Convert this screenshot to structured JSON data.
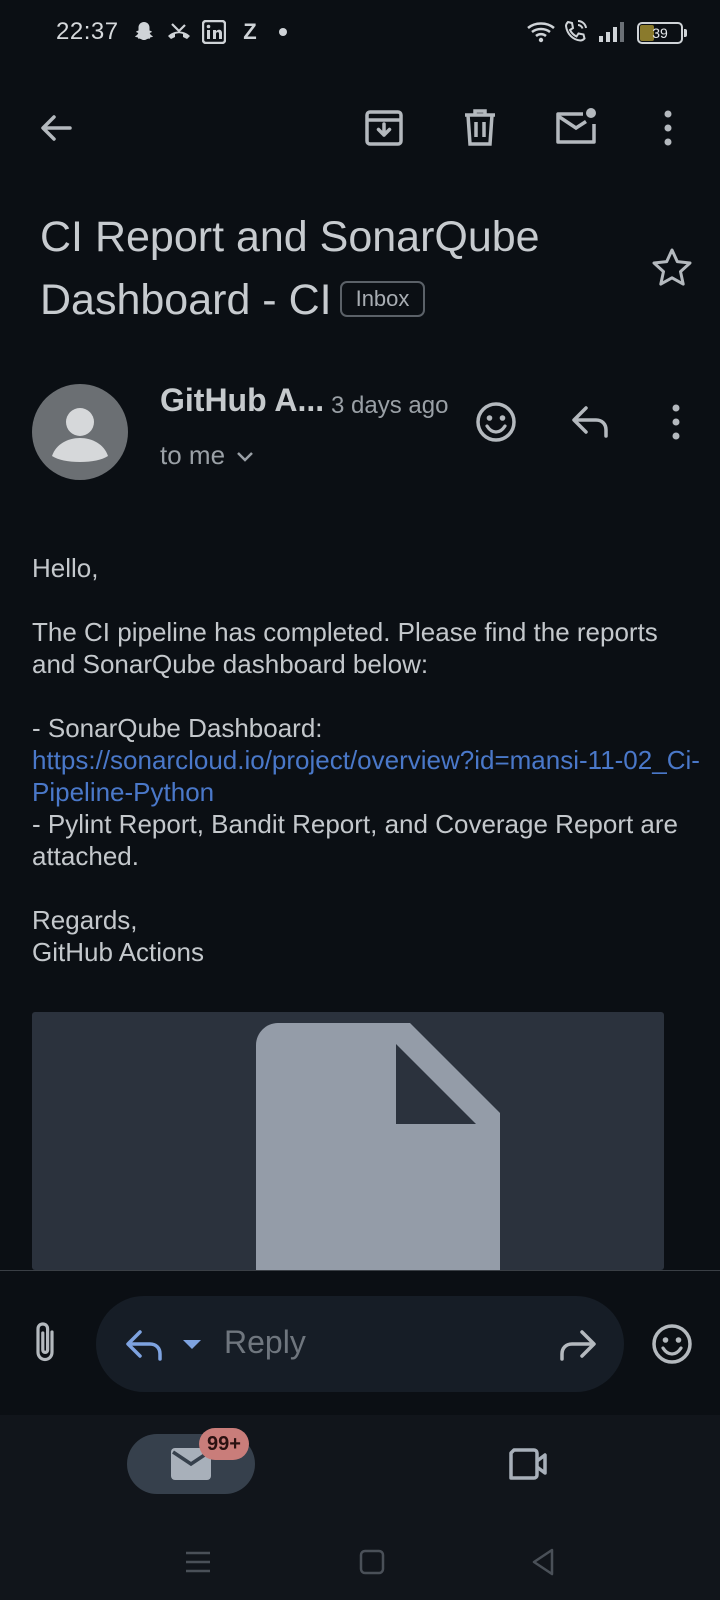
{
  "status_bar": {
    "time": "22:37",
    "left_icons": [
      "snapchat-icon",
      "missed-call-icon",
      "linkedin-icon",
      "z-icon",
      "dot-icon"
    ],
    "right_icons": [
      "wifi-icon",
      "wifi-calling-icon",
      "signal-icon"
    ],
    "battery_level": "39"
  },
  "toolbar": {
    "icons": [
      "back-arrow-icon",
      "archive-icon",
      "delete-icon",
      "mark-unread-icon",
      "more-vert-icon"
    ]
  },
  "email": {
    "subject": "CI Report and SonarQube Dashboard - CI",
    "label": "Inbox",
    "sender_name": "GitHub A...",
    "time": "3 days ago",
    "recipient": "to me",
    "body": {
      "greeting": "Hello,",
      "intro": "The CI pipeline has completed. Please find the reports and SonarQube dashboard below:",
      "dashboard_label": "- SonarQube Dashboard:",
      "dashboard_url": "https://sonarcloud.io/project/overview?id=mansi-11-02_Ci-Pipeline-Python",
      "reports_line": "- Pylint Report, Bandit Report, and Coverage Report are attached.",
      "closing": "Regards,",
      "signature": "GitHub Actions"
    }
  },
  "reply_bar": {
    "placeholder": "Reply"
  },
  "bottom_nav": {
    "mail_badge": "99+"
  },
  "colors": {
    "background": "#0b0f14",
    "link": "#4a78c9",
    "badge": "#c97d7a"
  }
}
